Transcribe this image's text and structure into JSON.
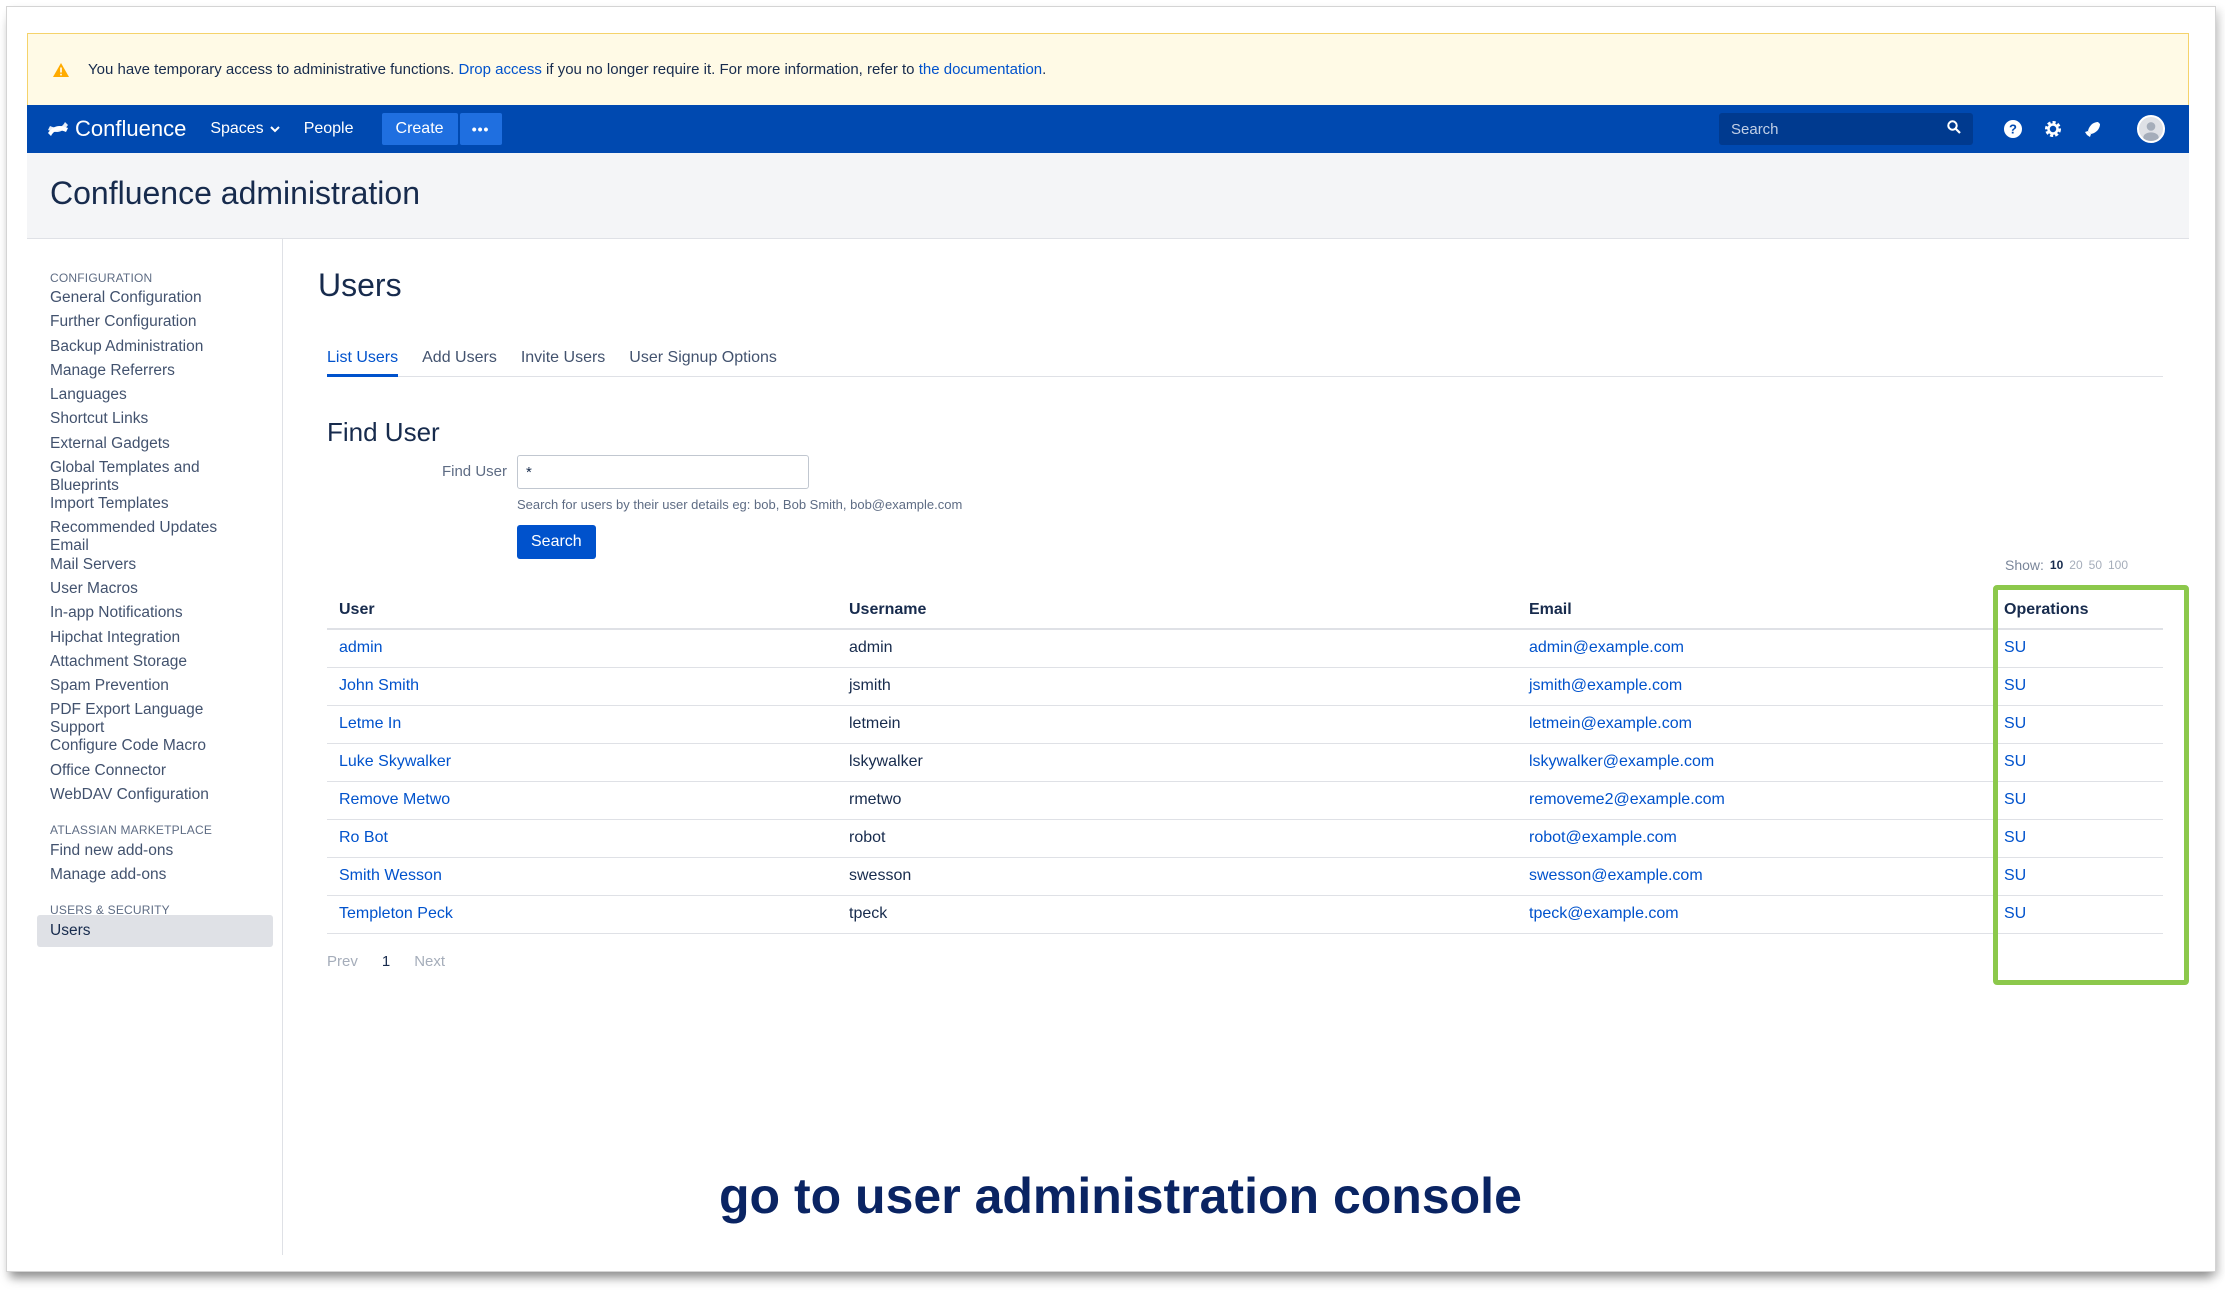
{
  "banner": {
    "text_before": "You have temporary access to administrative functions.",
    "link_drop": "Drop access",
    "text_middle": "if you no longer require it. For more information, refer to",
    "link_docs": "the documentation",
    "text_after": "."
  },
  "topnav": {
    "logo": "Confluence",
    "spaces": "Spaces",
    "people": "People",
    "create": "Create",
    "more": "•••",
    "search_placeholder": "Search"
  },
  "header": {
    "title": "Confluence administration"
  },
  "sidebar": {
    "configuration_heading": "CONFIGURATION",
    "configuration_items": [
      "General Configuration",
      "Further Configuration",
      "Backup Administration",
      "Manage Referrers",
      "Languages",
      "Shortcut Links",
      "External Gadgets",
      "Global Templates and Blueprints",
      "Import Templates",
      "Recommended Updates Email",
      "Mail Servers",
      "User Macros",
      "In-app Notifications",
      "Hipchat Integration",
      "Attachment Storage",
      "Spam Prevention",
      "PDF Export Language Support",
      "Configure Code Macro",
      "Office Connector",
      "WebDAV Configuration"
    ],
    "marketplace_heading": "ATLASSIAN MARKETPLACE",
    "marketplace_items": [
      "Find new add-ons",
      "Manage add-ons"
    ],
    "security_heading": "USERS & SECURITY",
    "security_items": [
      "Users"
    ]
  },
  "main": {
    "title": "Users",
    "tabs": [
      "List Users",
      "Add Users",
      "Invite Users",
      "User Signup Options"
    ],
    "find_title": "Find User",
    "find_label": "Find User",
    "find_value": "*",
    "find_hint": "Search for users by their user details eg: bob, Bob Smith, bob@example.com",
    "search_button": "Search",
    "show_label": "Show:",
    "show_options": [
      "10",
      "20",
      "50",
      "100"
    ],
    "columns": [
      "User",
      "Username",
      "Email",
      "Operations"
    ],
    "rows": [
      {
        "name": "admin",
        "username": "admin",
        "email": "admin@example.com",
        "op": "SU"
      },
      {
        "name": "John Smith",
        "username": "jsmith",
        "email": "jsmith@example.com",
        "op": "SU"
      },
      {
        "name": "Letme In",
        "username": "letmein",
        "email": "letmein@example.com",
        "op": "SU"
      },
      {
        "name": "Luke Skywalker",
        "username": "lskywalker",
        "email": "lskywalker@example.com",
        "op": "SU"
      },
      {
        "name": "Remove Metwo",
        "username": "rmetwo",
        "email": "removeme2@example.com",
        "op": "SU"
      },
      {
        "name": "Ro Bot",
        "username": "robot",
        "email": "robot@example.com",
        "op": "SU"
      },
      {
        "name": "Smith Wesson",
        "username": "swesson",
        "email": "swesson@example.com",
        "op": "SU"
      },
      {
        "name": "Templeton Peck",
        "username": "tpeck",
        "email": "tpeck@example.com",
        "op": "SU"
      }
    ],
    "pager": {
      "prev": "Prev",
      "current": "1",
      "next": "Next"
    }
  },
  "caption": "go to user administration console",
  "colors": {
    "nav": "#0049b0",
    "link": "#0052cc",
    "highlight": "#8cc84b",
    "caption": "#0a2463"
  }
}
